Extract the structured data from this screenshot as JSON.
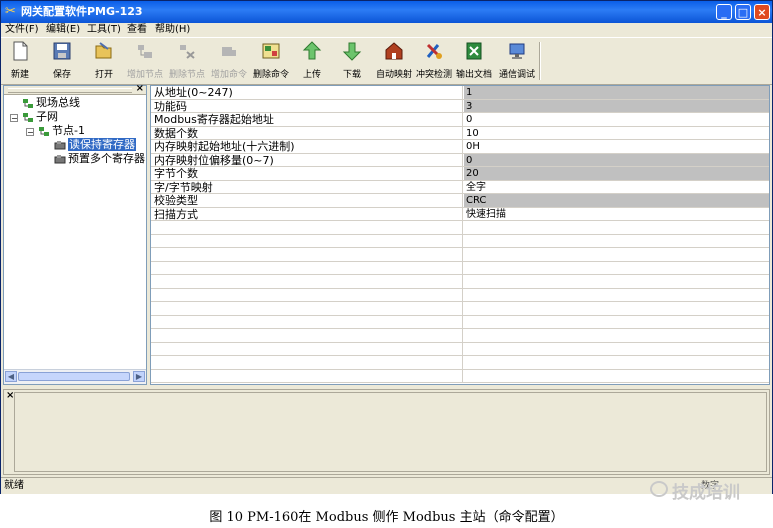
{
  "window": {
    "title": "网关配置软件PMG-123"
  },
  "menu": [
    "文件(F)",
    "编辑(E)",
    "工具(T)",
    "查看",
    "帮助(H)"
  ],
  "toolbar": [
    {
      "label": "新建"
    },
    {
      "label": "保存"
    },
    {
      "label": "打开"
    },
    {
      "label": "增加节点"
    },
    {
      "label": "删除节点"
    },
    {
      "label": "增加命令"
    },
    {
      "label": "删除命令"
    },
    {
      "label": "上传"
    },
    {
      "label": "下载"
    },
    {
      "label": "自动映射"
    },
    {
      "label": "冲突检测"
    },
    {
      "label": "输出文档"
    },
    {
      "label": "通信调试"
    }
  ],
  "tree": {
    "items": [
      {
        "label": "现场总线"
      },
      {
        "label": "子网"
      },
      {
        "label": "节点-1"
      },
      {
        "label": "读保持寄存器"
      },
      {
        "label": "预置多个寄存器"
      }
    ]
  },
  "grid": {
    "rows": [
      {
        "key": "从地址(0~247)",
        "value": "1"
      },
      {
        "key": "功能码",
        "value": "3"
      },
      {
        "key": "Modbus寄存器起始地址",
        "value": "0"
      },
      {
        "key": "数据个数",
        "value": "10"
      },
      {
        "key": "内存映射起始地址(十六进制)",
        "value": "0H"
      },
      {
        "key": "内存映射位偏移量(0~7)",
        "value": "0"
      },
      {
        "key": "字节个数",
        "value": "20"
      },
      {
        "key": "字/字节映射",
        "value": "全字"
      },
      {
        "key": "校验类型",
        "value": "CRC"
      },
      {
        "key": "扫描方式",
        "value": "快速扫描"
      }
    ]
  },
  "status": {
    "text": "就绪",
    "num": "数字"
  },
  "caption": "图 10  PM-160在 Modbus 侧作 Modbus 主站（命令配置）",
  "watermark": "技成培训"
}
